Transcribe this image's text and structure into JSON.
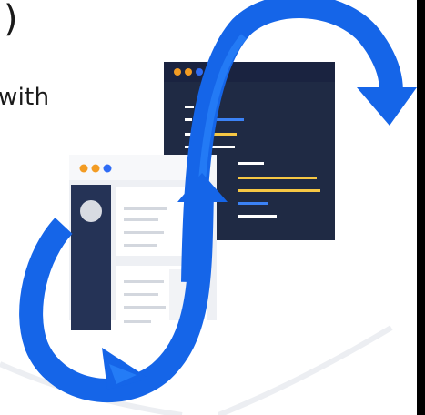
{
  "partial_text": {
    "top_fragment": ")",
    "line_fragment": "with"
  },
  "colors": {
    "background": "#ffffff",
    "loop_blue": "#1565e8",
    "loop_blue_light": "#2f8cff",
    "code_window": "#1f2a44",
    "code_yellow": "#f6c744",
    "code_blue": "#3b82f6",
    "code_white": "#ffffff",
    "browser_window": "#eef0f4",
    "browser_sidebar": "#253356",
    "dot_orange": "#f39c23",
    "dot_blue": "#2f6cf5"
  },
  "icons": {
    "loop": "infinity-loop-arrows",
    "code_window": "code-editor-window",
    "browser_window": "browser-window"
  }
}
